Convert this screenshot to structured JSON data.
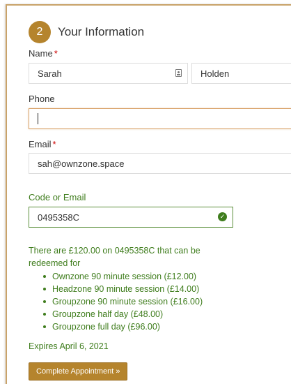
{
  "step": {
    "number": "2",
    "title": "Your Information"
  },
  "name": {
    "label": "Name",
    "required_mark": "*",
    "first_value": "Sarah",
    "last_value": "Holden"
  },
  "phone": {
    "label": "Phone",
    "value": ""
  },
  "email": {
    "label": "Email",
    "required_mark": "*",
    "value": "sah@ownzone.space"
  },
  "code": {
    "label": "Code or Email",
    "value": "0495358C"
  },
  "redeem": {
    "message": "There are £120.00 on 0495358C that can be redeemed for",
    "options": [
      "Ownzone 90 minute session (£12.00)",
      "Headzone 90 minute session (£14.00)",
      "Groupzone 90 minute session (£16.00)",
      "Groupzone half day (£48.00)",
      "Groupzone full day (£96.00)"
    ],
    "expires": "Expires April 6, 2021"
  },
  "submit_label": "Complete Appointment »",
  "icons": {
    "contact_card": "contact-card-icon",
    "valid_check": "check-circle-icon"
  },
  "colors": {
    "accent": "#b5842d",
    "success": "#3f7d1d",
    "required": "#cc0000"
  }
}
